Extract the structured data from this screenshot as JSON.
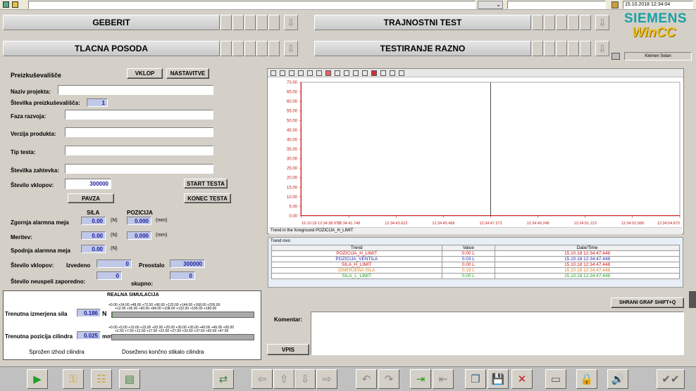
{
  "topbar": {
    "datetime": "15.10.2018 12:34:04"
  },
  "header": {
    "left_banner_1": "GEBERIT",
    "left_banner_2": "TLACNA POSODA",
    "right_banner_1": "TRAJNOSTNI TEST",
    "right_banner_2": "TESTIRANJE RAZNO",
    "logo_top": "SIEMENS",
    "logo_bottom": "WinCC",
    "user": "Klemen Selan"
  },
  "form": {
    "title": "Preizkuševališče",
    "vklop": "VKLOP",
    "nastavitve": "NASTAVITVE",
    "naziv_label": "Naziv projekta:",
    "stevilka_label": "Številka preizkuševališča:",
    "stevilka_value": "1",
    "faza_label": "Faza razvoja:",
    "verzija_label": "Verzija produkta:",
    "tip_label": "Tip testa:",
    "zahtevek_label": "Številka zahtevka:",
    "vklopov_label": "Število vklopov:",
    "vklopov_value": "300000",
    "start": "START TESTA",
    "pavza": "PAVZA",
    "konec": "KONEC TESTA"
  },
  "alarms": {
    "sila": "SILA",
    "pozicija": "POZICIJA",
    "zgornja": "Zgornja alarmna meja",
    "meritev": "Meritev:",
    "spodnja": "Spodnja alarmna meja",
    "zg_sila": "0.00",
    "zg_poz": "0.000",
    "me_sila": "0.00",
    "me_poz": "0.000",
    "sp_sila": "0.00",
    "unit_n": "(N)",
    "unit_mm": "(mm)"
  },
  "counts": {
    "stevilo_label": "Število vklopov:",
    "izvedeno": "Izvedeno",
    "izvedeno_val": "0",
    "preostalo": "Preostalo",
    "preostalo_val": "300000",
    "neuspeli": "Število neuspeli zaporedno:",
    "neuspeli_val": "0",
    "skupno": "skupno:",
    "skupno_val": "0"
  },
  "sim": {
    "title": "REALNA SIMULACIJA",
    "sila_label": "Trenutna izmerjena sila",
    "sila_val": "0.186",
    "sila_unit": "N",
    "scale1_top": "+0.00   +24.00   +48.00   +72.00   +96.00  +120.00  +144.00  +168.00   +200.00",
    "scale1_bot": "+12.00   +36.00   +60.00   +84.00  +108.00  +132.00  +156.00  +180.00",
    "poz_label": "Trenutna pozicija cilindra",
    "poz_val": "0.025",
    "poz_unit": "mm",
    "scale2_top": "+0.00  +5.00  +10.00 +15.00 +20.00 +25.00 +30.00 +35.00 +40.00 +45.00 +50.00",
    "scale2_bot": "+2.50  +7.50  +12.50 +17.50 +22.50 +27.50 +32.50 +37.50 +42.50 +47.50",
    "izhod": "Sprožen izhod cilindra",
    "koncno": "Doseženo končno stikalo cilindra"
  },
  "chart_data": {
    "type": "line",
    "ylim": [
      0,
      70
    ],
    "yticks": [
      "70.00",
      "65.00",
      "60.00",
      "55.00",
      "50.00",
      "45.00",
      "40.00",
      "35.00",
      "30.00",
      "25.00",
      "20.00",
      "15.00",
      "10.00",
      "5.00",
      "0.00"
    ],
    "xticks": [
      "15.10.18 12:34:38.873",
      "12:34:41.748",
      "12:34:43.623",
      "12:34:45.498",
      "12:34:47.373",
      "12:34:49.248",
      "12:34:51.123",
      "12:34:52.998",
      "12:34:54.873"
    ],
    "cursor_x_fraction": 0.5,
    "foreground": "Trend in the foreground POZICIJA_H_LIMIT"
  },
  "trend_table": {
    "title": "Trend nivo",
    "headers": [
      "Trend",
      "Value",
      "Date/Time"
    ],
    "rows": [
      {
        "name": "POZICIJA_H_LIMIT",
        "value": "0.00 L",
        "time": "15.10.18 12:34:47.448",
        "color": "#d01010"
      },
      {
        "name": "POZICIJA_VENTILA",
        "value": "0.03 L",
        "time": "15.10.18 12:34:47.448",
        "color": "#2020b0"
      },
      {
        "name": "SILA_H_LIMIT",
        "value": "0.00 L",
        "time": "15.10.18 12:34:47.448",
        "color": "#d01010"
      },
      {
        "name": "IZMERJENA SILA",
        "value": "0.19 L",
        "time": "15.10.18 12:34:47.448",
        "color": "#e08020"
      },
      {
        "name": "SILA_L_LIMIT",
        "value": "0.00 L",
        "time": "15.10.18 12:34:47.448",
        "color": "#20a020"
      }
    ]
  },
  "actions": {
    "shrani": "SHRANI GRAF SHIFT+Q",
    "komentar": "Komentar:",
    "vpis": "VPIS"
  }
}
